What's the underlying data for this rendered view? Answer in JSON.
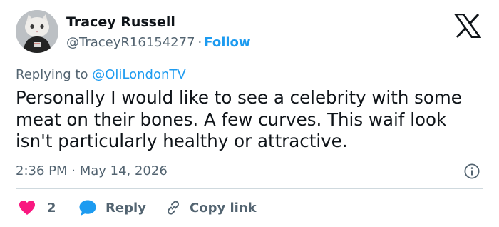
{
  "author": {
    "name": "Tracey Russell",
    "handle": "@TraceyR16154277",
    "separator": "·",
    "follow_label": "Follow",
    "avatar_icon": "cat-avatar"
  },
  "platform_logo": "x-logo",
  "reply_context": {
    "prefix": "Replying to",
    "mention": "@OliLondonTV"
  },
  "tweet": {
    "lines": [
      "Personally I would like to see a celebrity with some",
      "meat on their bones. A few curves. This waif look",
      "isn't particularly healthy or attractive."
    ],
    "timestamp": "2:36 PM · May 14, 2026"
  },
  "actions": {
    "like_count": "2",
    "reply_label": "Reply",
    "copy_link_label": "Copy link"
  },
  "colors": {
    "accent": "#1d9bf0",
    "like": "#f91880",
    "secondary_text": "#536471",
    "primary_text": "#0f1419",
    "divider": "#cfd9de"
  }
}
